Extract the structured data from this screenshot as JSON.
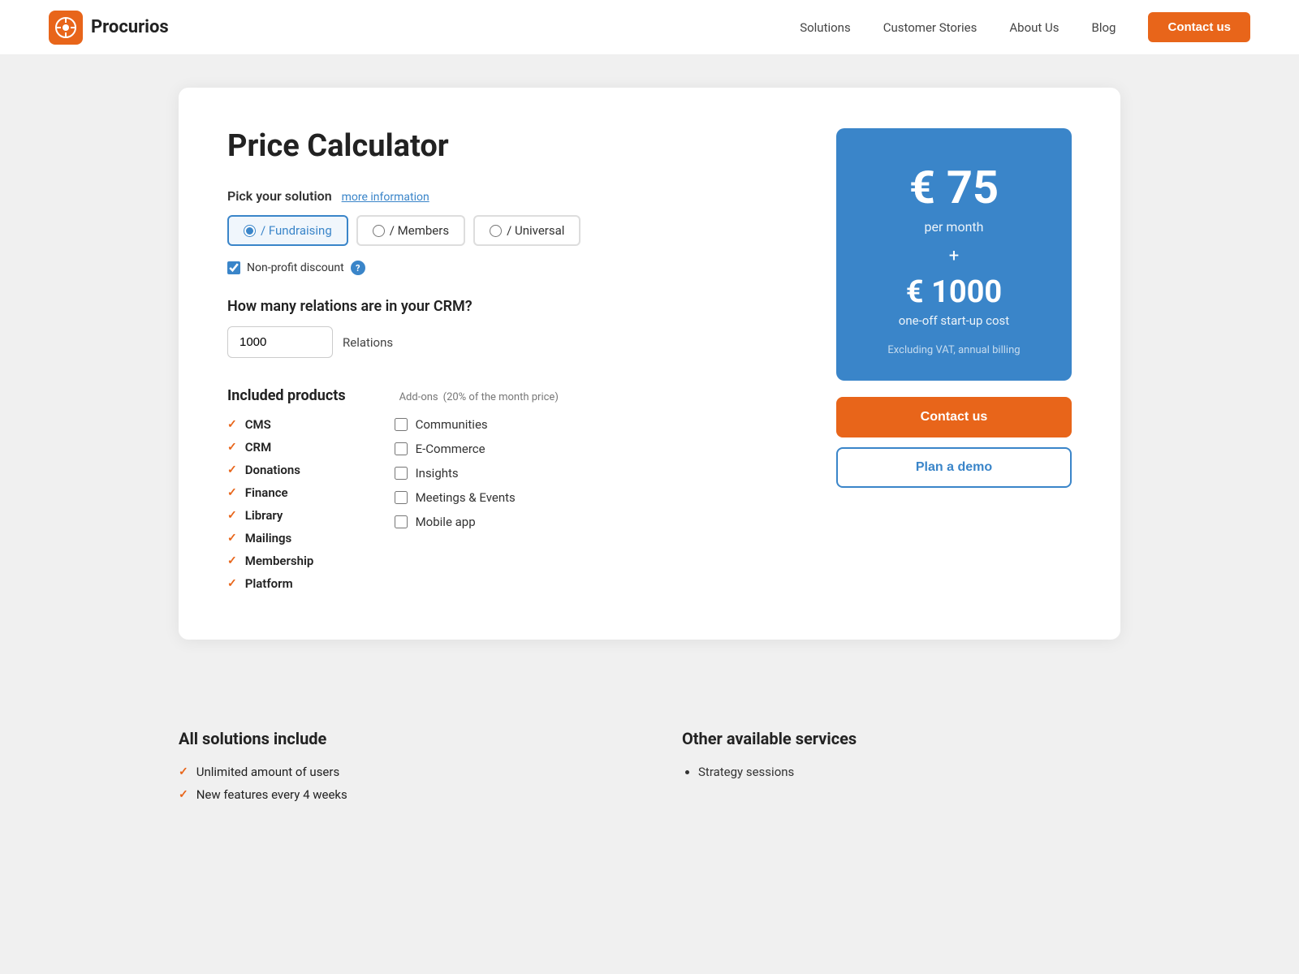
{
  "nav": {
    "logo_text": "Procurios",
    "links": [
      "Solutions",
      "Customer Stories",
      "About Us",
      "Blog"
    ],
    "contact_btn": "Contact us"
  },
  "calculator": {
    "title": "Price Calculator",
    "pick_solution_label": "Pick your solution",
    "more_info_link": "more information",
    "solutions": [
      {
        "id": "fundraising",
        "label": "/ Fundraising",
        "active": true
      },
      {
        "id": "members",
        "label": "/ Members",
        "active": false
      },
      {
        "id": "universal",
        "label": "/ Universal",
        "active": false
      }
    ],
    "nonprofit_discount_label": "Non-profit discount",
    "crm_question": "How many relations are in your CRM?",
    "crm_value": "1000",
    "crm_unit": "Relations",
    "included_products_label": "Included products",
    "included_products": [
      "CMS",
      "CRM",
      "Donations",
      "Finance",
      "Library",
      "Mailings",
      "Membership",
      "Platform"
    ],
    "addons_label": "Add-ons",
    "addons_note": "(20% of the month price)",
    "addons": [
      "Communities",
      "E-Commerce",
      "Insights",
      "Meetings & Events",
      "Mobile app"
    ],
    "price_main": "€ 75",
    "price_per": "per month",
    "price_plus": "+",
    "price_startup": "€ 1000",
    "price_startup_label": "one-off start-up cost",
    "price_note": "Excluding VAT, annual billing",
    "contact_btn": "Contact us",
    "demo_btn": "Plan a demo"
  },
  "footer": {
    "all_solutions_label": "All solutions include",
    "all_solutions_items": [
      "Unlimited amount of users",
      "New features every 4 weeks"
    ],
    "other_services_label": "Other available services",
    "other_services_items": [
      "Strategy sessions"
    ]
  }
}
